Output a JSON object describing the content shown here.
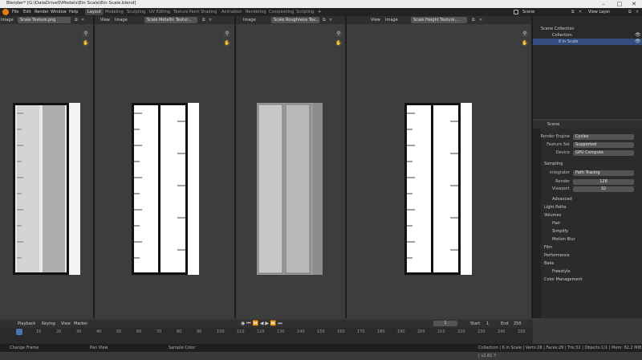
{
  "titlebar": {
    "title": "Blender* [G:\\DataDrive0\\Models\\Ein Scale\\6in Scale.blend]"
  },
  "menus": [
    "File",
    "Edit",
    "Render",
    "Window",
    "Help"
  ],
  "workspaces": [
    "Layout",
    "Modeling",
    "Sculpting",
    "UV Editing",
    "Texture Paint",
    "Shading",
    "Animation",
    "Rendering",
    "Compositing",
    "Scripting"
  ],
  "scene": {
    "name": "Scene",
    "view_layer": "View Layer"
  },
  "editors": [
    {
      "view": "View",
      "image": "Image",
      "texture": "Scale Texture.png"
    },
    {
      "view": "View",
      "image": "Image",
      "texture": "Scale Metallic Textur..."
    },
    {
      "view": "View",
      "image": "Image",
      "texture": "Scale Roughness Tex..."
    },
    {
      "view": "View",
      "image": "Image",
      "texture": "Scale Height Texture..."
    }
  ],
  "outliner": {
    "root": "Scene Collection",
    "collection": "Collection",
    "object": "6 in Scale"
  },
  "properties": {
    "scene_label": "Scene",
    "render_engine_label": "Render Engine",
    "render_engine": "Cycles",
    "feature_set_label": "Feature Set",
    "feature_set": "Supported",
    "device_label": "Device",
    "device": "GPU Compute",
    "sampling": "Sampling",
    "integrator_label": "Integrator",
    "integrator": "Path Tracing",
    "render_label": "Render",
    "render_value": "128",
    "viewport_label": "Viewport",
    "viewport_value": "32",
    "advanced": "Advanced",
    "light_paths": "Light Paths",
    "volumes": "Volumes",
    "hair": "Hair",
    "simplify": "Simplify",
    "motion_blur": "Motion Blur",
    "film": "Film",
    "performance": "Performance",
    "bake": "Bake",
    "freestyle": "Freestyle",
    "color_management": "Color Management"
  },
  "timeline": {
    "playback": "Playback",
    "keying": "Keying",
    "view": "View",
    "marker": "Marker",
    "current_frame": "1",
    "start_label": "Start",
    "start": "1",
    "end_label": "End",
    "end": "250",
    "ticks": [
      "1",
      "10",
      "20",
      "30",
      "40",
      "50",
      "60",
      "70",
      "80",
      "90",
      "100",
      "110",
      "120",
      "130",
      "140",
      "150",
      "160",
      "170",
      "180",
      "190",
      "200",
      "210",
      "220",
      "230",
      "240",
      "250"
    ]
  },
  "statusbar": {
    "change_frame": "Change Frame",
    "pan_view": "Pan View",
    "sample_color": "Sample Color",
    "stats": "Collection | 6 in Scale | Verts:28 | Faces:26 | Tris:52 | Objects:1/1 | Mem: 62.2 MiB | v2.82.7"
  }
}
